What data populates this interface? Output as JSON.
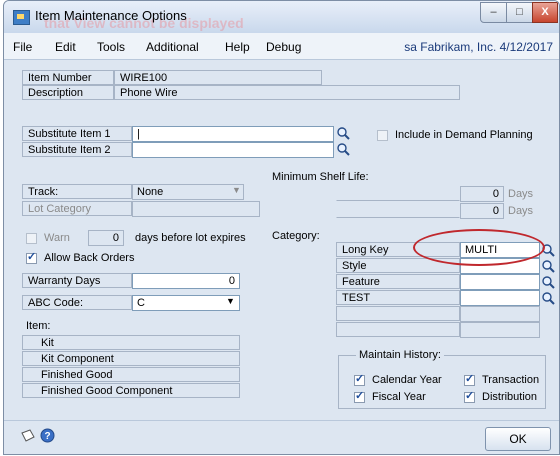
{
  "window": {
    "title": "Item Maintenance Options",
    "ghost_text": "that  View  cannot  be  displayed",
    "buttons": {
      "minimize": "–",
      "maximize": "□",
      "close": "X"
    }
  },
  "menu": {
    "items": [
      "File",
      "Edit",
      "Tools",
      "Additional",
      "Help",
      "Debug"
    ],
    "status": "sa  Fabrikam, Inc.  4/12/2017"
  },
  "item": {
    "number_label": "Item Number",
    "number": "WIRE100",
    "description_label": "Description",
    "description": "Phone Wire"
  },
  "substitutes": {
    "item1_label": "Substitute Item 1",
    "item1_value": "|",
    "item2_label": "Substitute Item 2",
    "item2_value": ""
  },
  "demand_planning": {
    "label": "Include in Demand Planning",
    "checked": false
  },
  "min_shelf_life": {
    "label": "Minimum Shelf Life:",
    "value1": "0",
    "value2": "0",
    "unit": "Days"
  },
  "track": {
    "label": "Track:",
    "value": "None"
  },
  "lot_category": {
    "label": "Lot Category",
    "value": ""
  },
  "warn": {
    "label": "Warn",
    "value": "0",
    "suffix": "days before lot expires",
    "checked": false
  },
  "allow_back_orders": {
    "label": "Allow Back Orders",
    "checked": true
  },
  "warranty": {
    "label": "Warranty Days",
    "value": "0"
  },
  "abc": {
    "label": "ABC Code:",
    "value": "C"
  },
  "item_types": {
    "label": "Item:",
    "rows": [
      "Kit",
      "Kit Component",
      "Finished Good",
      "Finished Good Component"
    ]
  },
  "category": {
    "label": "Category:",
    "rows": [
      {
        "name": "Long Key",
        "value": "MULTI"
      },
      {
        "name": "Style",
        "value": ""
      },
      {
        "name": "Feature",
        "value": ""
      },
      {
        "name": "TEST",
        "value": ""
      },
      {
        "name": "",
        "value": ""
      },
      {
        "name": "",
        "value": ""
      }
    ]
  },
  "history": {
    "label": "Maintain History:",
    "calendar_year": "Calendar Year",
    "fiscal_year": "Fiscal Year",
    "transaction": "Transaction",
    "distribution": "Distribution"
  },
  "footer": {
    "ok": "OK"
  },
  "colors": {
    "accent": "#1f4e9c",
    "highlight": "#c0282d"
  }
}
